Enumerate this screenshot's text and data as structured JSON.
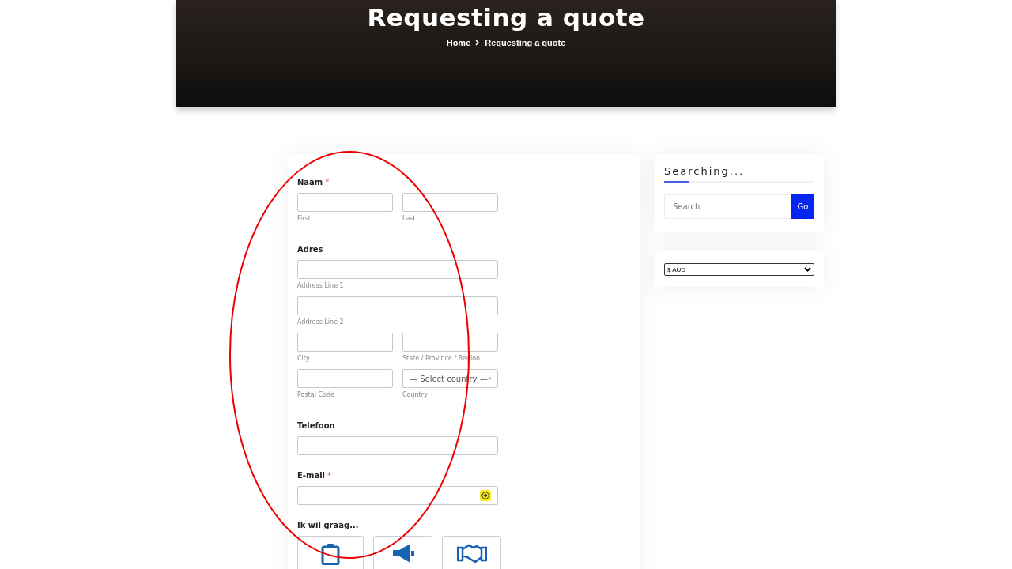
{
  "hero": {
    "title": "Requesting a quote",
    "breadcrumb": [
      {
        "label": "Home"
      },
      {
        "label": "Requesting a quote"
      }
    ]
  },
  "form": {
    "groups": [
      {
        "kind": "name",
        "label": "Naam",
        "required_mark": "*",
        "fields": [
          {
            "sublabel": "First"
          },
          {
            "sublabel": "Last"
          }
        ]
      },
      {
        "kind": "address",
        "label": "Adres",
        "rows": [
          [
            {
              "sublabel": "Address Line 1"
            }
          ],
          [
            {
              "sublabel": "Address Line 2"
            }
          ],
          [
            {
              "sublabel": "City"
            },
            {
              "sublabel": "State / Province / Region"
            }
          ],
          [
            {
              "sublabel": "Postal Code"
            },
            {
              "sublabel": "Country",
              "select": "— Select country —"
            }
          ]
        ]
      },
      {
        "kind": "single",
        "label": "Telefoon",
        "autofill_badge": false
      },
      {
        "kind": "single",
        "label": "E-mail",
        "required_mark": "*",
        "autofill_badge": true
      },
      {
        "kind": "options",
        "label": "Ik wil graag...",
        "tiles": [
          {
            "kind": "clipboard"
          },
          {
            "kind": "megaphone"
          },
          {
            "kind": "handshake"
          }
        ]
      }
    ]
  },
  "sidebar": {
    "search_widget": {
      "title": "Searching...",
      "placeholder": "Search",
      "button": "Go"
    },
    "currency": {
      "value": "$ AUD"
    }
  },
  "annotation": {
    "ellipse": true
  }
}
